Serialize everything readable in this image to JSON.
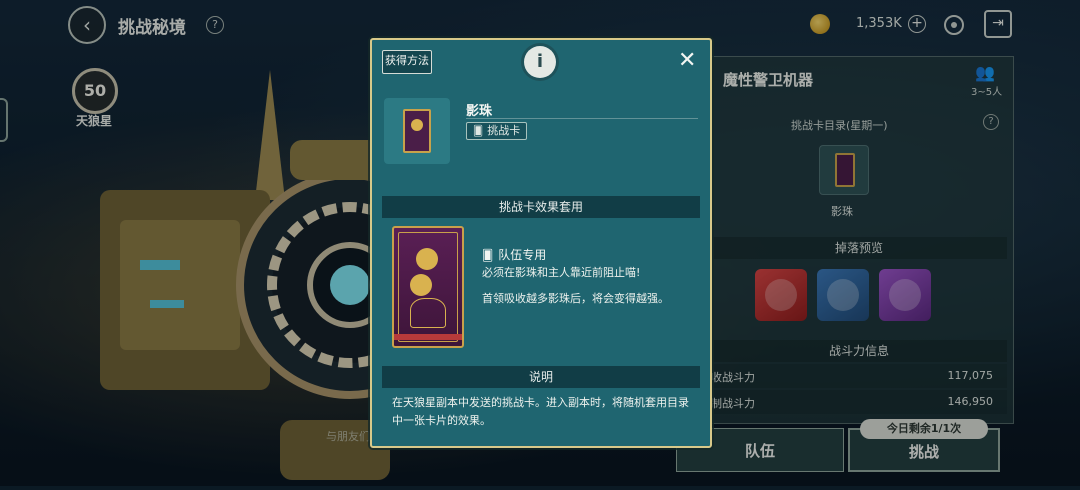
{
  "header": {
    "title": "挑战秘境",
    "help_label": "?",
    "back_label": "‹",
    "coin_value": "1,353K",
    "plus_label": "+",
    "exit_label": "⇥"
  },
  "left": {
    "level": "50",
    "level_name": "天狼星",
    "invite_text": "与朋友们一起打败强敌的怪物"
  },
  "right_panel": {
    "title": "魔性警卫机器",
    "people": "3~5人",
    "catalog_label": "挑战卡目录(星期一)",
    "catalog_help": "?",
    "card_name": "影珠",
    "drop_header": "掉落预览",
    "power_header": "战斗力信息",
    "rows": [
      {
        "label": "收战斗力",
        "value": "117,075"
      },
      {
        "label": "制战斗力",
        "value": "146,950"
      }
    ],
    "team_button": "队伍",
    "fight_button": "挑战",
    "remaining_badge": "今日剩余1/1次"
  },
  "modal": {
    "acquire_button": "获得方法",
    "info_label": "i",
    "close_label": "✕",
    "item_name": "影珠",
    "item_type": "挑战卡",
    "effect_header": "挑战卡效果套用",
    "effect_title": "队伍专用",
    "effect_line1": "必须在影珠和主人靠近前阻止喵!",
    "effect_line2": "首领吸收越多影珠后，将会变得越强。",
    "desc_header": "说明",
    "desc_text": "在天狼星副本中发送的挑战卡。进入副本时，将随机套用目录中一张卡片的效果。"
  }
}
